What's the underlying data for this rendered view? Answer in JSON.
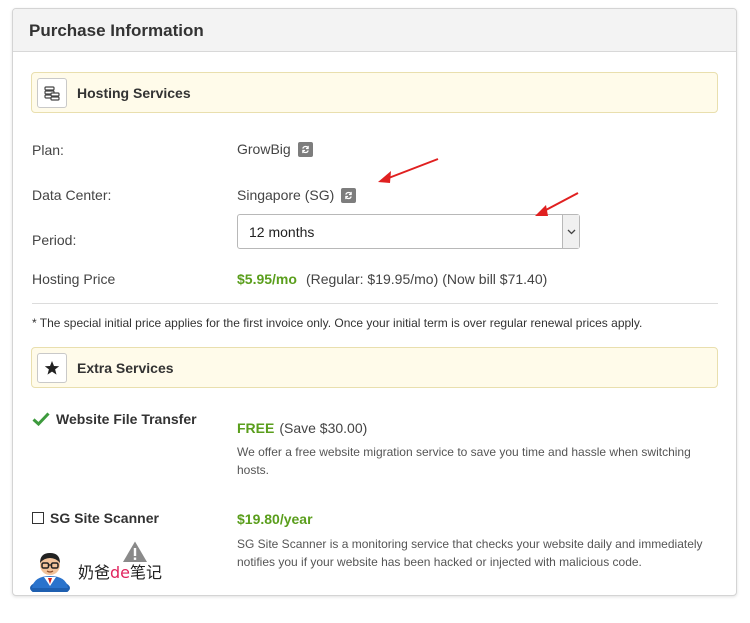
{
  "panel": {
    "title": "Purchase Information"
  },
  "hosting": {
    "title": "Hosting Services",
    "icon": "stack-icon",
    "plan": {
      "label": "Plan:",
      "value": "GrowBig"
    },
    "data_center": {
      "label": "Data Center:",
      "value": "Singapore (SG)"
    },
    "period": {
      "label": "Period:",
      "value": "12 months"
    },
    "price": {
      "label": "Hosting Price",
      "amount": "$5.95/mo",
      "regular": "(Regular: $19.95/mo)",
      "now_bill": "(Now bill $71.40)"
    },
    "note": "* The special initial price applies for the first invoice only. Once your initial term is over regular renewal prices apply."
  },
  "extra": {
    "title": "Extra Services",
    "icon": "star-icon",
    "items": [
      {
        "name": "Website File Transfer",
        "checked": true,
        "price": "FREE",
        "save": "(Save $30.00)",
        "desc": "We offer a free website migration service to save you time and hassle when switching hosts."
      },
      {
        "name": "SG Site Scanner",
        "checked": false,
        "price": "$19.80/year",
        "desc": "SG Site Scanner is a monitoring service that checks your website daily and immediately notifies you if your website has been hacked or injected with malicious code."
      }
    ]
  },
  "watermark": {
    "text_before": "奶爸",
    "text_de": "de",
    "text_after": "笔记"
  },
  "colors": {
    "green": "#5a9e1c",
    "arrow_red": "#e02020",
    "section_bg": "#fffbea"
  }
}
